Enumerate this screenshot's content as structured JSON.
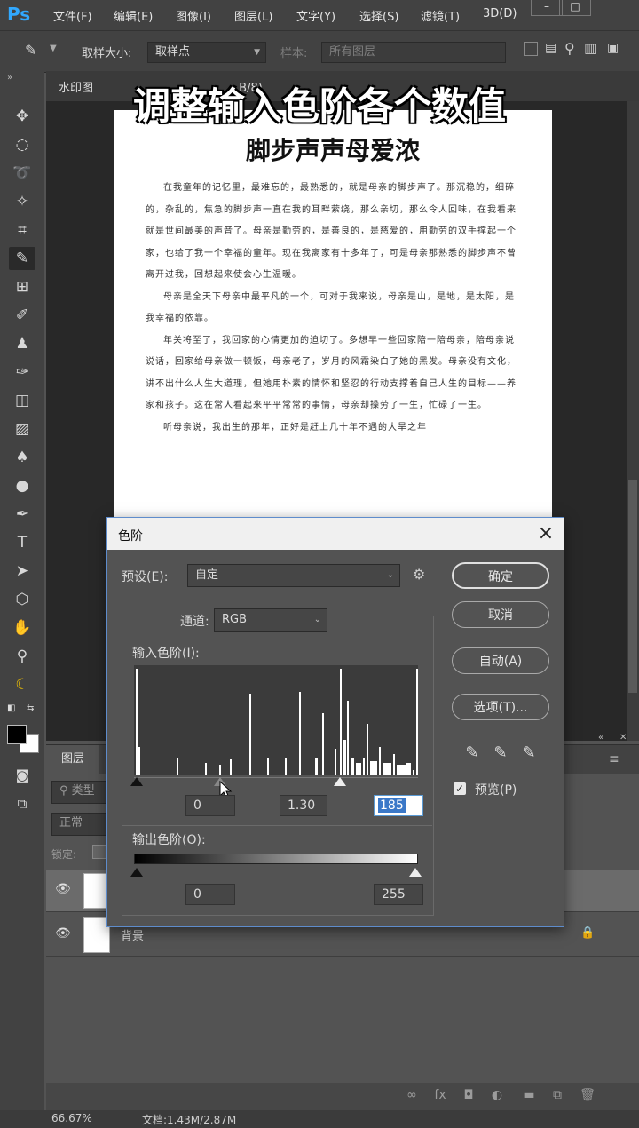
{
  "app": {
    "logo": "Ps"
  },
  "menu": [
    "文件(F)",
    "编辑(E)",
    "图像(I)",
    "图层(L)",
    "文字(Y)",
    "选择(S)",
    "滤镜(T)",
    "3D(D)"
  ],
  "window_controls": [
    "–",
    "□"
  ],
  "options_bar": {
    "sample_size_label": "取样大小:",
    "sample_size_value": "取样点",
    "sample_label": "样本:",
    "sample_value": "所有图层"
  },
  "doc_tab": {
    "label": "水印图",
    "info": "B/8)"
  },
  "overlay_caption": "调整输入色阶各个数值",
  "document": {
    "title": "脚步声声母爱浓",
    "paragraphs": [
      "在我童年的记忆里，最难忘的，最熟悉的，就是母亲的脚步声了。那沉稳的，细碎的，杂乱的，焦急的脚步声一直在我的耳畔萦绕，那么亲切，那么令人回味，在我看来就是世间最美的声音了。母亲是勤劳的，是善良的，是慈爱的，用勤劳的双手撑起一个家，也给了我一个幸福的童年。现在我离家有十多年了，可是母亲那熟悉的脚步声不曾离开过我，回想起来使会心生温暖。",
      "母亲是全天下母亲中最平凡的一个，可对于我来说，母亲是山，是地，是太阳，是我幸福的依靠。",
      "年关将至了，我回家的心情更加的迫切了。多想早一些回家陪一陪母亲，陪母亲说说话，回家给母亲做一顿饭，母亲老了，岁月的风霜染白了她的黑发。母亲没有文化，讲不出什么人生大道理，但她用朴素的情怀和坚忍的行动支撑着自己人生的目标——养家和孩子。这在常人看起来平平常常的事情，母亲却操劳了一生，忙碌了一生。",
      "听母亲说，我出生的那年，正好是赶上几十年不遇的大旱之年"
    ]
  },
  "layers_panel": {
    "tab": "图层",
    "search_placeholder": "类型",
    "blend_mode": "正常",
    "lock_label": "锁定:",
    "layers": [
      {
        "name": "",
        "selected": true
      },
      {
        "name": "背景",
        "locked": true
      }
    ]
  },
  "status_bar": {
    "zoom": "66.67%",
    "doc_info": "文档:1.43M/2.87M"
  },
  "levels_dialog": {
    "title": "色阶",
    "preset_label": "预设(E):",
    "preset_value": "自定",
    "channel_label": "通道:",
    "channel_value": "RGB",
    "input_levels_label": "输入色阶(I):",
    "input_black": "0",
    "input_gamma": "1.30",
    "input_white": "185",
    "output_levels_label": "输出色阶(O):",
    "output_black": "0",
    "output_white": "255",
    "buttons": {
      "ok": "确定",
      "cancel": "取消",
      "auto": "自动(A)",
      "options": "选项(T)..."
    },
    "preview_label": "预览(P)",
    "preview_checked": true
  }
}
